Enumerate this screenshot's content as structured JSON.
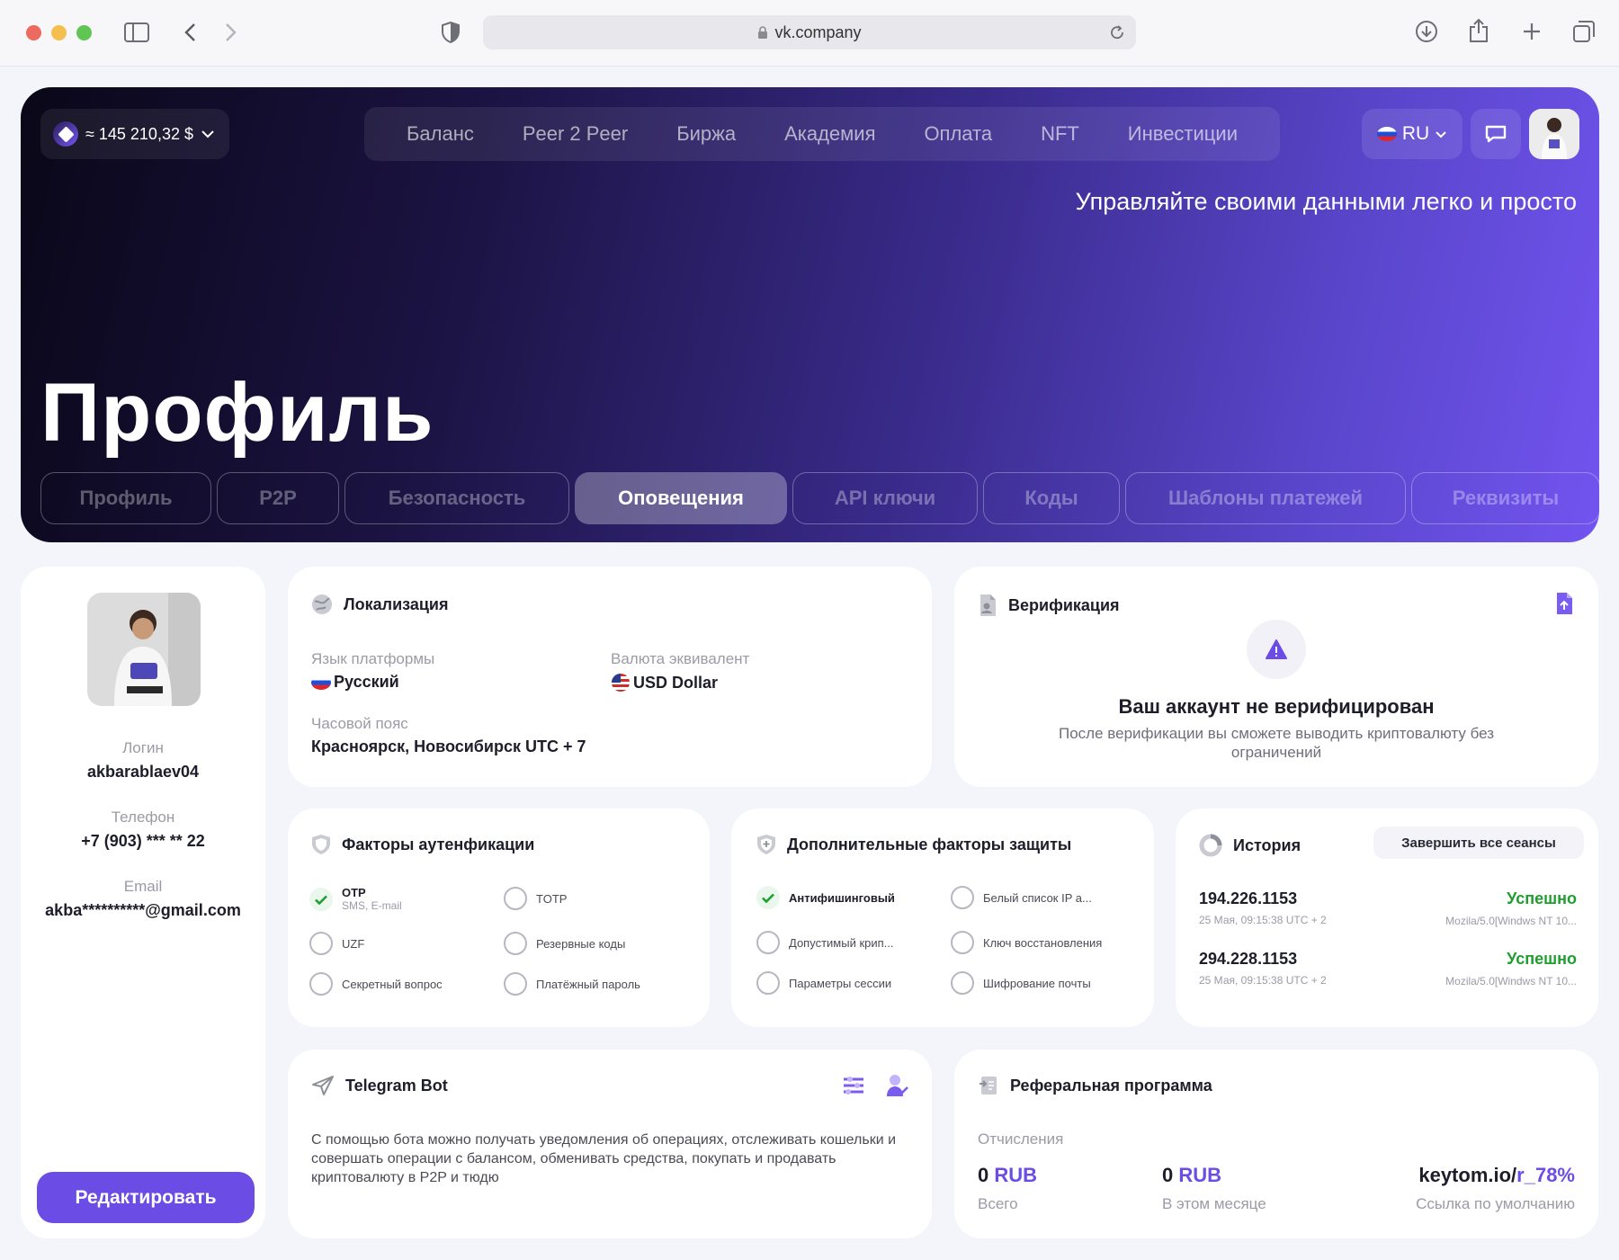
{
  "browser": {
    "url": "vk.company"
  },
  "wallet": {
    "balance": "≈ 145 210,32 $"
  },
  "nav": {
    "items": [
      "Баланс",
      "Peer 2 Peer",
      "Биржа",
      "Академия",
      "Оплата",
      "NFT",
      "Инвестиции"
    ]
  },
  "lang": {
    "code": "RU"
  },
  "hero": {
    "tagline": "Управляйте своими данными легко и просто",
    "title": "Профиль"
  },
  "tabs": [
    "Профиль",
    "P2P",
    "Безопасность",
    "Оповещения",
    "API ключи",
    "Коды",
    "Шаблоны платежей",
    "Реквизиты"
  ],
  "profile": {
    "login_label": "Логин",
    "login": "akbarablaev04",
    "phone_label": "Телефон",
    "phone": "+7 (903) *** ** 22",
    "email_label": "Email",
    "email": "akba**********@gmail.com",
    "edit_button": "Редактировать"
  },
  "localization": {
    "title": "Локализация",
    "language_label": "Язык платформы",
    "language": "Русский",
    "currency_label": "Валюта эквивалент",
    "currency": "USD Dollar",
    "timezone_label": "Часовой пояс",
    "timezone": "Красноярск, Новосибирск UTC + 7"
  },
  "verification": {
    "title": "Верификация",
    "heading": "Ваш аккаунт не верифицирован",
    "text": "После верификации вы сможете выводить криптовалюту без ограничений"
  },
  "auth_factors": {
    "title": "Факторы аутенфикации",
    "otp": "OTP",
    "otp_sub": "SMS, E-mail",
    "totp": "TOTP",
    "uzf": "UZF",
    "backup": "Резервные коды",
    "secret": "Секретный вопрос",
    "payment": "Платёжный пароль"
  },
  "extra_factors": {
    "title": "Дополнительные факторы защиты",
    "antiphishing": "Антифишинговый",
    "whitelist": "Белый список IP а...",
    "allowed_crypto": "Допустимый крип...",
    "recovery": "Ключ восстановления",
    "session": "Параметры сессии",
    "encryption": "Шифрование почты"
  },
  "history": {
    "title": "История",
    "end_sessions": "Завершить все сеансы",
    "rows": [
      {
        "ip": "194.226.1153",
        "status": "Успешно",
        "date": "25 Мая, 09:15:38 UTC + 2",
        "agent": "Mozila/5.0[Windws NT 10..."
      },
      {
        "ip": "294.228.1153",
        "status": "Успешно",
        "date": "25 Мая, 09:15:38 UTC + 2",
        "agent": "Mozila/5.0[Windws NT 10..."
      }
    ]
  },
  "telegram": {
    "title": "Telegram Bot",
    "text": "С помощью бота можно получать уведомления об операциях, отслеживать кошельки и совершать операции с балансом, обменивать средства, покупать и продавать криптовалюту в P2P и тюдю"
  },
  "referral": {
    "title": "Реферальная программа",
    "deductions_label": "Отчисления",
    "total_amount": "0",
    "total_currency": "RUB",
    "total_label": "Всего",
    "month_amount": "0",
    "month_currency": "RUB",
    "month_label": "В этом месяце",
    "link_prefix": "keytom.io/",
    "link_code": "r_78%",
    "link_label": "Ссылка по умолчанию"
  },
  "colors": {
    "accent": "#6b4de6",
    "success": "#1e9e2e",
    "hero_dark": "#0a0718"
  }
}
